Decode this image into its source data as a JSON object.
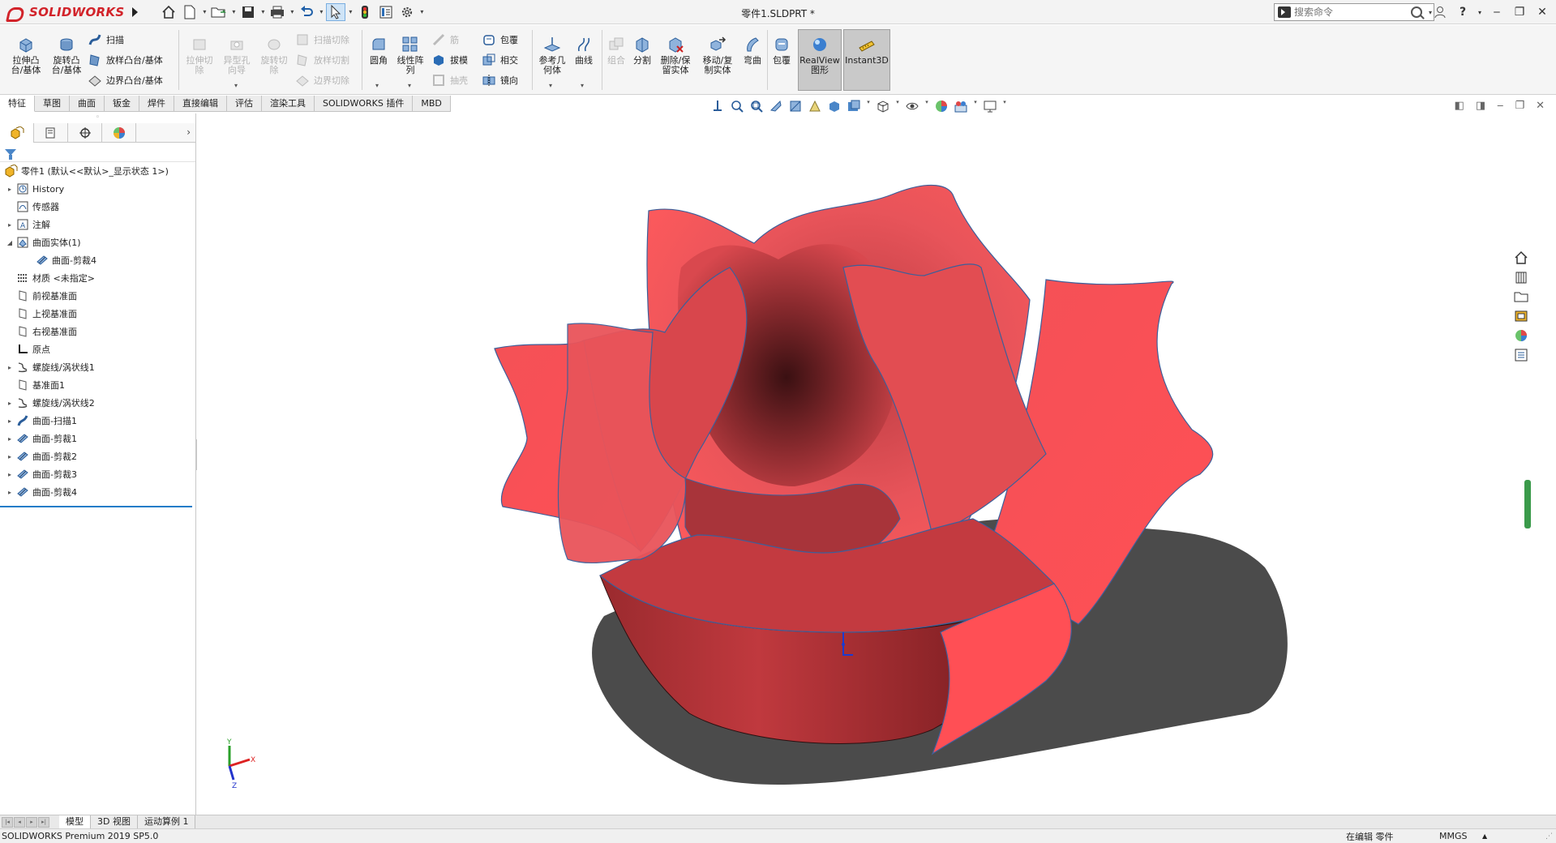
{
  "app": {
    "logo_text": "SOLIDWORKS",
    "document_title": "零件1.SLDPRT *",
    "search_placeholder": "搜索命令"
  },
  "ribbon": {
    "extrude_boss": "拉伸凸\n台/基体",
    "revolve_boss": "旋转凸\n台/基体",
    "sweep": "扫描",
    "loft_boss": "放样凸台/基体",
    "boundary_boss": "边界凸台/基体",
    "extrude_cut": "拉伸切\n除",
    "hole_wizard": "异型孔\n向导",
    "revolve_cut": "旋转切\n除",
    "swept_cut": "扫描切除",
    "lofted_cut": "放样切割",
    "boundary_cut": "边界切除",
    "fillet": "圆角",
    "linear_pattern": "线性阵\n列",
    "rib": "筋",
    "draft": "拔模",
    "shell": "抽壳",
    "wrap": "包覆",
    "intersect": "相交",
    "mirror": "镜向",
    "reference_geometry": "参考几\n何体",
    "curves": "曲线",
    "combine": "组合",
    "split": "分割",
    "delete_keep_body": "删除/保\n留实体",
    "move_copy_body": "移动/复\n制实体",
    "flex": "弯曲",
    "wrap2": "包覆",
    "realview": "RealView\n图形",
    "instant3d": "Instant3D"
  },
  "tabs": [
    "特征",
    "草图",
    "曲面",
    "钣金",
    "焊件",
    "直接编辑",
    "评估",
    "渲染工具",
    "SOLIDWORKS 插件",
    "MBD"
  ],
  "active_tab": "特征",
  "tree": {
    "root": "零件1 (默认<<默认>_显示状态 1>)",
    "items": [
      {
        "label": "History",
        "expandable": true
      },
      {
        "label": "传感器",
        "expandable": false
      },
      {
        "label": "注解",
        "expandable": true
      },
      {
        "label": "曲面实体(1)",
        "expandable": true,
        "expanded": true
      },
      {
        "label": "曲面-剪裁4",
        "child": true
      },
      {
        "label": "材质 <未指定>",
        "expandable": false
      },
      {
        "label": "前视基准面",
        "expandable": false
      },
      {
        "label": "上视基准面",
        "expandable": false
      },
      {
        "label": "右视基准面",
        "expandable": false
      },
      {
        "label": "原点",
        "expandable": false
      },
      {
        "label": "螺旋线/涡状线1",
        "expandable": true
      },
      {
        "label": "基准面1",
        "expandable": false
      },
      {
        "label": "螺旋线/涡状线2",
        "expandable": true
      },
      {
        "label": "曲面-扫描1",
        "expandable": true
      },
      {
        "label": "曲面-剪裁1",
        "expandable": true
      },
      {
        "label": "曲面-剪裁2",
        "expandable": true
      },
      {
        "label": "曲面-剪裁3",
        "expandable": true
      },
      {
        "label": "曲面-剪裁4",
        "expandable": true
      }
    ]
  },
  "bottom_tabs": [
    "模型",
    "3D 视图",
    "运动算例 1"
  ],
  "active_bottom_tab": "模型",
  "status": {
    "product": "SOLIDWORKS Premium 2019 SP5.0",
    "editing": "在编辑 零件",
    "units": "MMGS",
    "units_arrow": "▲"
  },
  "colors": {
    "brand_red": "#d2232a",
    "petal_red": "#e64a4f",
    "shadow": "#4b4b4b"
  }
}
